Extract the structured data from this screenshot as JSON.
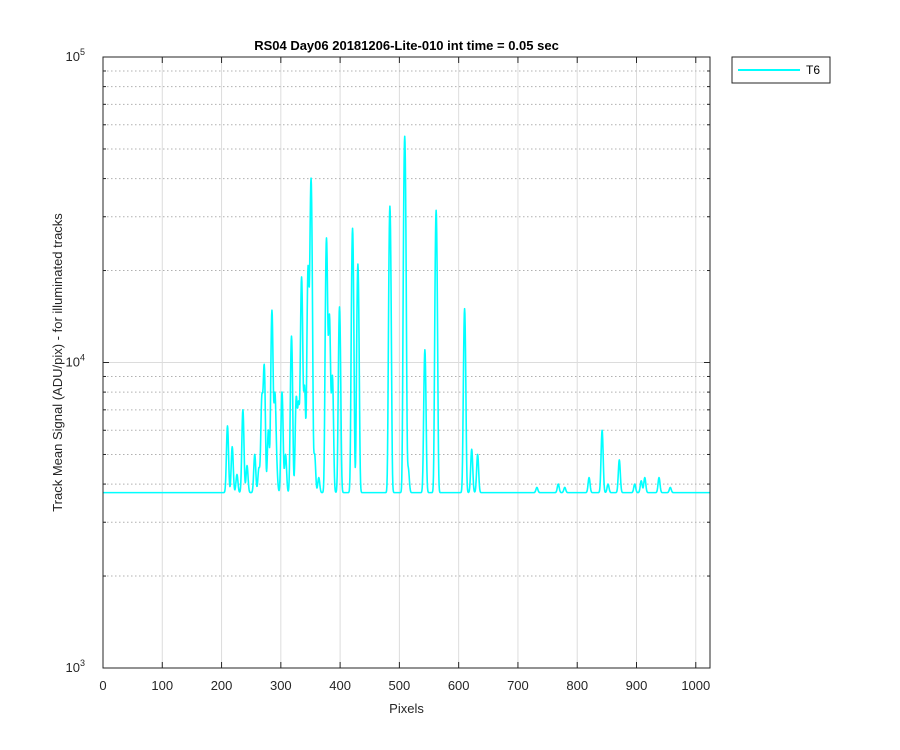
{
  "chart_data": {
    "type": "line",
    "title": "RS04 Day06 20181206-Lite-010 int time = 0.05 sec",
    "xlabel": "Pixels",
    "ylabel": "Track Mean Signal (ADU/pix) - for illuminated tracks",
    "xlim": [
      0,
      1024
    ],
    "ylim": [
      1000,
      100000
    ],
    "yscale": "log",
    "xticks": [
      0,
      100,
      200,
      300,
      400,
      500,
      600,
      700,
      800,
      900,
      1000
    ],
    "xtick_labels": [
      "0",
      "100",
      "200",
      "300",
      "400",
      "500",
      "600",
      "700",
      "800",
      "900",
      "1000"
    ],
    "yticks": [
      1000,
      10000,
      100000
    ],
    "ytick_labels": [
      {
        "base": "10",
        "exp": "3"
      },
      {
        "base": "10",
        "exp": "4"
      },
      {
        "base": "10",
        "exp": "5"
      }
    ],
    "grid": {
      "x": "solid",
      "y_major": "solid",
      "y_minor": "dotted"
    },
    "legend": {
      "position": "outside-top-right",
      "entries": [
        "T6"
      ]
    },
    "series": [
      {
        "name": "T6",
        "color": "#00FFFF",
        "baseline": 3750,
        "peaks": [
          {
            "x": 210,
            "y": 6200
          },
          {
            "x": 218,
            "y": 5300
          },
          {
            "x": 226,
            "y": 4300
          },
          {
            "x": 236,
            "y": 7000
          },
          {
            "x": 243,
            "y": 4600
          },
          {
            "x": 256,
            "y": 5000
          },
          {
            "x": 263,
            "y": 4500
          },
          {
            "x": 268,
            "y": 7600
          },
          {
            "x": 272,
            "y": 9700
          },
          {
            "x": 279,
            "y": 6000
          },
          {
            "x": 285,
            "y": 14800
          },
          {
            "x": 290,
            "y": 7800
          },
          {
            "x": 293,
            "y": 4400
          },
          {
            "x": 302,
            "y": 8000
          },
          {
            "x": 308,
            "y": 5000
          },
          {
            "x": 318,
            "y": 12200
          },
          {
            "x": 326,
            "y": 7600
          },
          {
            "x": 330,
            "y": 7200
          },
          {
            "x": 335,
            "y": 19000
          },
          {
            "x": 340,
            "y": 8300
          },
          {
            "x": 346,
            "y": 20500
          },
          {
            "x": 351,
            "y": 40000
          },
          {
            "x": 357,
            "y": 5000
          },
          {
            "x": 364,
            "y": 4200
          },
          {
            "x": 377,
            "y": 25500
          },
          {
            "x": 382,
            "y": 14200
          },
          {
            "x": 387,
            "y": 9000
          },
          {
            "x": 399,
            "y": 15200
          },
          {
            "x": 421,
            "y": 27500
          },
          {
            "x": 430,
            "y": 21000
          },
          {
            "x": 484,
            "y": 32500
          },
          {
            "x": 509,
            "y": 55000
          },
          {
            "x": 515,
            "y": 4500
          },
          {
            "x": 543,
            "y": 11000
          },
          {
            "x": 562,
            "y": 31500
          },
          {
            "x": 610,
            "y": 15000
          },
          {
            "x": 622,
            "y": 5200
          },
          {
            "x": 632,
            "y": 5000
          },
          {
            "x": 732,
            "y": 3900
          },
          {
            "x": 768,
            "y": 4000
          },
          {
            "x": 779,
            "y": 3900
          },
          {
            "x": 820,
            "y": 4200
          },
          {
            "x": 842,
            "y": 6000
          },
          {
            "x": 852,
            "y": 4000
          },
          {
            "x": 871,
            "y": 4800
          },
          {
            "x": 897,
            "y": 4000
          },
          {
            "x": 908,
            "y": 4100
          },
          {
            "x": 914,
            "y": 4200
          },
          {
            "x": 938,
            "y": 4200
          },
          {
            "x": 957,
            "y": 3900
          }
        ]
      }
    ]
  }
}
